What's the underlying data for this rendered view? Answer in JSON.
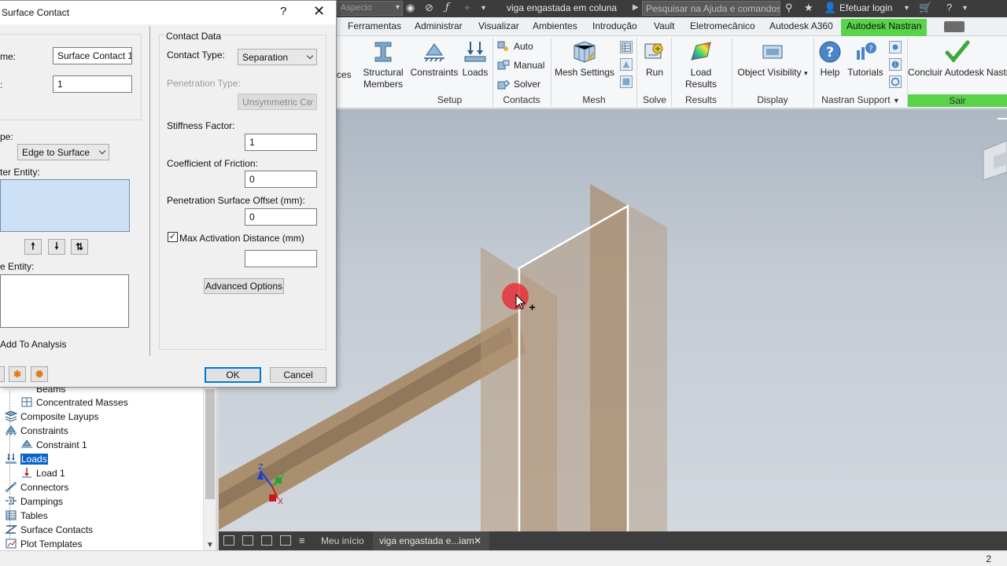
{
  "titlebar": {
    "doc_dropdown": "Aspecto",
    "document_title": "viga engastada em coluna",
    "search_placeholder": "Pesquisar na Ajuda e comandos...",
    "login_label": "Efetuar login"
  },
  "tabs": [
    {
      "label": "Ferramentas"
    },
    {
      "label": "Administrar"
    },
    {
      "label": "Visualizar"
    },
    {
      "label": "Ambientes"
    },
    {
      "label": "Introdução"
    },
    {
      "label": "Vault"
    },
    {
      "label": "Eletromecânico"
    },
    {
      "label": "Autodesk A360"
    },
    {
      "label": "Autodesk Nastran",
      "active": true
    }
  ],
  "ribbon": {
    "partial_label": "ces",
    "structural_members": "Structural Members",
    "constraints": "Constraints",
    "loads": "Loads",
    "auto": "Auto",
    "manual": "Manual",
    "solver": "Solver",
    "mesh_settings": "Mesh Settings",
    "run": "Run",
    "load_results": "Load Results",
    "object_visibility": "Object Visibility",
    "help": "Help",
    "tutorials": "Tutorials",
    "finish": "Concluir Autodesk Nastran In-CAD",
    "groups": {
      "setup": "Setup",
      "contacts": "Contacts",
      "mesh": "Mesh",
      "solve": "Solve",
      "results": "Results",
      "display": "Display",
      "nastran_support": "Nastran Support",
      "exit": "Sair"
    }
  },
  "dialog": {
    "title": "Surface Contact",
    "name_label": "me:",
    "name_value": "Surface Contact 1",
    "id_label": ":",
    "id_value": "1",
    "type_label": "pe:",
    "type_value": "Edge to Surface",
    "master_label": "ter Entity:",
    "slave_label": "e Entity:",
    "add_to_analysis": "Add To Analysis",
    "contact_data_title": "Contact Data",
    "contact_type_label": "Contact Type:",
    "contact_type_value": "Separation",
    "penetration_type_label": "Penetration Type:",
    "penetration_type_value": "Unsymmetric Co",
    "stiffness_label": "Stiffness Factor:",
    "stiffness_value": "1",
    "friction_label": "Coefficient of Friction:",
    "friction_value": "0",
    "offset_label": "Penetration Surface Offset (mm):",
    "offset_value": "0",
    "max_activation_label": "Max Activation Distance (mm)",
    "max_activation_checked": true,
    "max_activation_value": "",
    "advanced_options": "Advanced Options",
    "ok": "OK",
    "cancel": "Cancel"
  },
  "tree": {
    "items": [
      {
        "label": "Beams"
      },
      {
        "label": "Concentrated Masses"
      },
      {
        "label": "Composite Layups"
      },
      {
        "label": "Constraints"
      },
      {
        "label": "Constraint 1"
      },
      {
        "label": "Loads",
        "selected": true
      },
      {
        "label": "Load 1"
      },
      {
        "label": "Connectors"
      },
      {
        "label": "Dampings"
      },
      {
        "label": "Tables"
      },
      {
        "label": "Surface Contacts"
      },
      {
        "label": "Plot Templates"
      }
    ]
  },
  "viewport_tabs": {
    "home": "Meu início",
    "document": "viga engastada e...iam"
  },
  "triad": {
    "x": "X",
    "y": "Y",
    "z": "Z"
  },
  "status": {
    "page_number": "2"
  }
}
